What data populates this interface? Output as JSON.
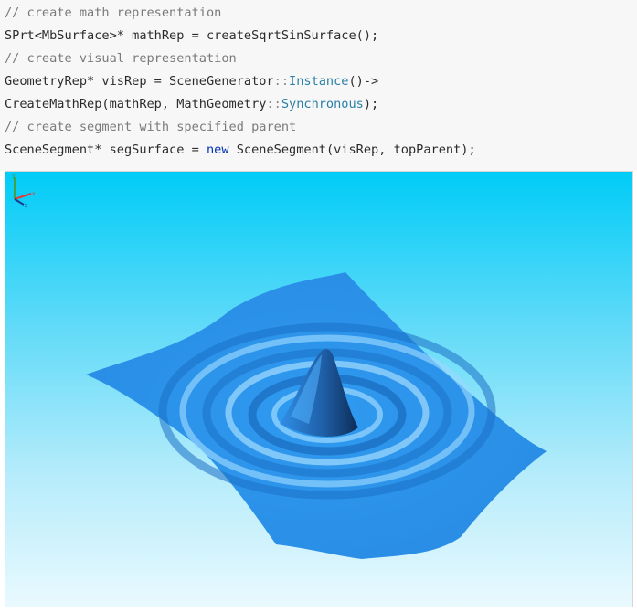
{
  "code": {
    "lines": [
      {
        "parts": [
          {
            "cls": "cm",
            "text": "// create math representation"
          }
        ]
      },
      {
        "parts": [
          {
            "cls": "",
            "text": "SPrt<MbSurface>* mathRep = createSqrtSinSurface();"
          }
        ]
      },
      {
        "parts": [
          {
            "cls": "cm",
            "text": "// create visual representation"
          }
        ]
      },
      {
        "parts": [
          {
            "cls": "",
            "text": "GeometryRep* visRep = SceneGenerator"
          },
          {
            "cls": "op",
            "text": "::"
          },
          {
            "cls": "fn",
            "text": "Instance"
          },
          {
            "cls": "",
            "text": "()->"
          }
        ]
      },
      {
        "parts": [
          {
            "cls": "",
            "text": "CreateMathRep(mathRep, MathGeometry"
          },
          {
            "cls": "op",
            "text": "::"
          },
          {
            "cls": "fn",
            "text": "Synchronous"
          },
          {
            "cls": "",
            "text": ");"
          }
        ]
      },
      {
        "parts": [
          {
            "cls": "cm",
            "text": "// create segment with specified parent"
          }
        ]
      },
      {
        "parts": [
          {
            "cls": "",
            "text": "SceneSegment* segSurface = "
          },
          {
            "cls": "kw",
            "text": "new"
          },
          {
            "cls": "",
            "text": " SceneSegment(visRep, topParent);"
          }
        ]
      }
    ]
  },
  "viewport": {
    "axes": {
      "x_label": "x",
      "y_label": "y",
      "z_label": "z"
    },
    "colors": {
      "surface": "#2f9bf0",
      "surface_dark": "#1461b0",
      "surface_light": "#8fd4ff",
      "axis_x": "#e53935",
      "axis_y": "#43a047",
      "axis_z": "#1e3a8a"
    }
  }
}
